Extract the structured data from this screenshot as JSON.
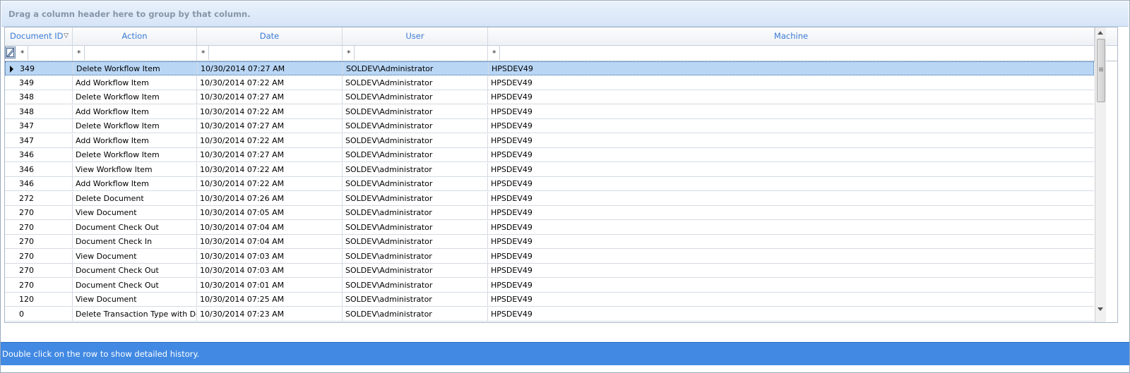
{
  "group_panel": {
    "hint": "Drag a column header here to group by that column."
  },
  "columns": [
    {
      "key": "doc_id",
      "label": "Document ID"
    },
    {
      "key": "action",
      "label": "Action"
    },
    {
      "key": "date",
      "label": "Date"
    },
    {
      "key": "user",
      "label": "User"
    },
    {
      "key": "machine",
      "label": "Machine"
    }
  ],
  "filter": {
    "wildcard": "*"
  },
  "icons": {
    "sort": "sort-descending-icon",
    "filter_editor": "filter-editor-icon",
    "row_indicator": "row-pointer-icon"
  },
  "rows": [
    [
      "349",
      "Delete Workflow Item",
      "10/30/2014 07:27 AM",
      "SOLDEV\\Administrator",
      "HPSDEV49"
    ],
    [
      "349",
      "Add Workflow Item",
      "10/30/2014 07:22 AM",
      "SOLDEV\\Administrator",
      "HPSDEV49"
    ],
    [
      "348",
      "Delete Workflow Item",
      "10/30/2014 07:27 AM",
      "SOLDEV\\Administrator",
      "HPSDEV49"
    ],
    [
      "348",
      "Add Workflow Item",
      "10/30/2014 07:22 AM",
      "SOLDEV\\Administrator",
      "HPSDEV49"
    ],
    [
      "347",
      "Delete Workflow Item",
      "10/30/2014 07:27 AM",
      "SOLDEV\\Administrator",
      "HPSDEV49"
    ],
    [
      "347",
      "Add Workflow Item",
      "10/30/2014 07:22 AM",
      "SOLDEV\\Administrator",
      "HPSDEV49"
    ],
    [
      "346",
      "Delete Workflow Item",
      "10/30/2014 07:27 AM",
      "SOLDEV\\Administrator",
      "HPSDEV49"
    ],
    [
      "346",
      "View Workflow Item",
      "10/30/2014 07:22 AM",
      "SOLDEV\\administrator",
      "HPSDEV49"
    ],
    [
      "346",
      "Add Workflow Item",
      "10/30/2014 07:22 AM",
      "SOLDEV\\Administrator",
      "HPSDEV49"
    ],
    [
      "272",
      "Delete Document",
      "10/30/2014 07:26 AM",
      "SOLDEV\\Administrator",
      "HPSDEV49"
    ],
    [
      "270",
      "View Document",
      "10/30/2014 07:05 AM",
      "SOLDEV\\administrator",
      "HPSDEV49"
    ],
    [
      "270",
      "Document Check Out",
      "10/30/2014 07:04 AM",
      "SOLDEV\\Administrator",
      "HPSDEV49"
    ],
    [
      "270",
      "Document Check In",
      "10/30/2014 07:04 AM",
      "SOLDEV\\Administrator",
      "HPSDEV49"
    ],
    [
      "270",
      "View Document",
      "10/30/2014 07:03 AM",
      "SOLDEV\\administrator",
      "HPSDEV49"
    ],
    [
      "270",
      "Document Check Out",
      "10/30/2014 07:03 AM",
      "SOLDEV\\Administrator",
      "HPSDEV49"
    ],
    [
      "270",
      "Document Check Out",
      "10/30/2014 07:01 AM",
      "SOLDEV\\Administrator",
      "HPSDEV49"
    ],
    [
      "120",
      "View Document",
      "10/30/2014 07:25 AM",
      "SOLDEV\\administrator",
      "HPSDEV49"
    ],
    [
      "0",
      "Delete Transaction Type with Doc",
      "10/30/2014 07:23 AM",
      "SOLDEV\\administrator",
      "HPSDEV49"
    ]
  ],
  "selected_row": 0,
  "status_bar": {
    "text": "Double click on the row to show detailed history."
  }
}
